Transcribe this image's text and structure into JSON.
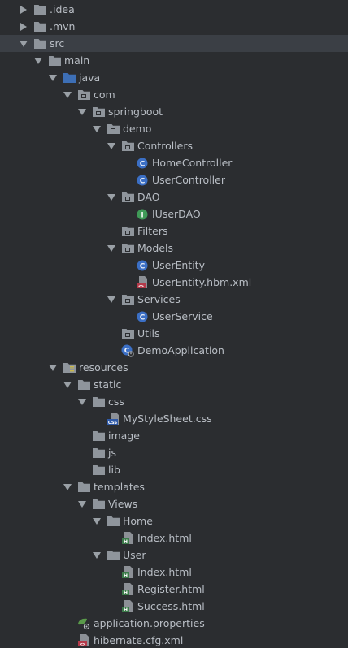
{
  "colors": {
    "background": "#2b2d30",
    "selection": "#3b3f45",
    "text": "#b9bec5",
    "folder": "#8f959c",
    "source_folder": "#3d6fb6",
    "class_icon": "#3b6fc5",
    "interface_icon": "#3f9a57",
    "html_file": "#3c7a4a",
    "css_file": "#2f5aa8",
    "xml_file": "#b43a4a"
  },
  "tree": {
    "items": [
      {
        "label": ".idea",
        "level": 0,
        "arrow": "right",
        "icon": "folder-icon"
      },
      {
        "label": ".mvn",
        "level": 0,
        "arrow": "right",
        "icon": "folder-icon"
      },
      {
        "label": "src",
        "level": 0,
        "arrow": "down",
        "icon": "folder-icon",
        "selected": true
      },
      {
        "label": "main",
        "level": 1,
        "arrow": "down",
        "icon": "folder-icon"
      },
      {
        "label": "java",
        "level": 2,
        "arrow": "down",
        "icon": "source-folder-icon"
      },
      {
        "label": "com",
        "level": 3,
        "arrow": "down",
        "icon": "package-icon"
      },
      {
        "label": "springboot",
        "level": 4,
        "arrow": "down",
        "icon": "package-icon"
      },
      {
        "label": "demo",
        "level": 5,
        "arrow": "down",
        "icon": "package-icon"
      },
      {
        "label": "Controllers",
        "level": 6,
        "arrow": "down",
        "icon": "package-icon"
      },
      {
        "label": "HomeController",
        "level": 7,
        "arrow": "none",
        "icon": "class-icon"
      },
      {
        "label": "UserController",
        "level": 7,
        "arrow": "none",
        "icon": "class-icon"
      },
      {
        "label": "DAO",
        "level": 6,
        "arrow": "down",
        "icon": "package-icon"
      },
      {
        "label": "IUserDAO",
        "level": 7,
        "arrow": "none",
        "icon": "interface-icon"
      },
      {
        "label": "Filters",
        "level": 6,
        "arrow": "none",
        "icon": "package-icon"
      },
      {
        "label": "Models",
        "level": 6,
        "arrow": "down",
        "icon": "package-icon"
      },
      {
        "label": "UserEntity",
        "level": 7,
        "arrow": "none",
        "icon": "class-icon"
      },
      {
        "label": "UserEntity.hbm.xml",
        "level": 7,
        "arrow": "none",
        "icon": "xml-file-icon"
      },
      {
        "label": "Services",
        "level": 6,
        "arrow": "down",
        "icon": "package-icon"
      },
      {
        "label": "UserService",
        "level": 7,
        "arrow": "none",
        "icon": "class-icon"
      },
      {
        "label": "Utils",
        "level": 6,
        "arrow": "none",
        "icon": "package-icon"
      },
      {
        "label": "DemoApplication",
        "level": 6,
        "arrow": "none",
        "icon": "spring-boot-app-icon"
      },
      {
        "label": "resources",
        "level": 2,
        "arrow": "down",
        "icon": "resources-folder-icon"
      },
      {
        "label": "static",
        "level": 3,
        "arrow": "down",
        "icon": "folder-icon"
      },
      {
        "label": "css",
        "level": 4,
        "arrow": "down",
        "icon": "folder-icon"
      },
      {
        "label": "MyStyleSheet.css",
        "level": 5,
        "arrow": "none",
        "icon": "css-file-icon"
      },
      {
        "label": "image",
        "level": 4,
        "arrow": "none",
        "icon": "folder-icon"
      },
      {
        "label": "js",
        "level": 4,
        "arrow": "none",
        "icon": "folder-icon"
      },
      {
        "label": "lib",
        "level": 4,
        "arrow": "none",
        "icon": "folder-icon"
      },
      {
        "label": "templates",
        "level": 3,
        "arrow": "down",
        "icon": "folder-icon"
      },
      {
        "label": "Views",
        "level": 4,
        "arrow": "down",
        "icon": "folder-icon"
      },
      {
        "label": "Home",
        "level": 5,
        "arrow": "down",
        "icon": "folder-icon"
      },
      {
        "label": "Index.html",
        "level": 6,
        "arrow": "none",
        "icon": "html-file-icon"
      },
      {
        "label": "User",
        "level": 5,
        "arrow": "down",
        "icon": "folder-icon"
      },
      {
        "label": "Index.html",
        "level": 6,
        "arrow": "none",
        "icon": "html-file-icon"
      },
      {
        "label": "Register.html",
        "level": 6,
        "arrow": "none",
        "icon": "html-file-icon"
      },
      {
        "label": "Success.html",
        "level": 6,
        "arrow": "none",
        "icon": "html-file-icon"
      },
      {
        "label": "application.properties",
        "level": 3,
        "arrow": "none",
        "icon": "spring-properties-icon"
      },
      {
        "label": "hibernate.cfg.xml",
        "level": 3,
        "arrow": "none",
        "icon": "xml-file-icon"
      }
    ]
  }
}
